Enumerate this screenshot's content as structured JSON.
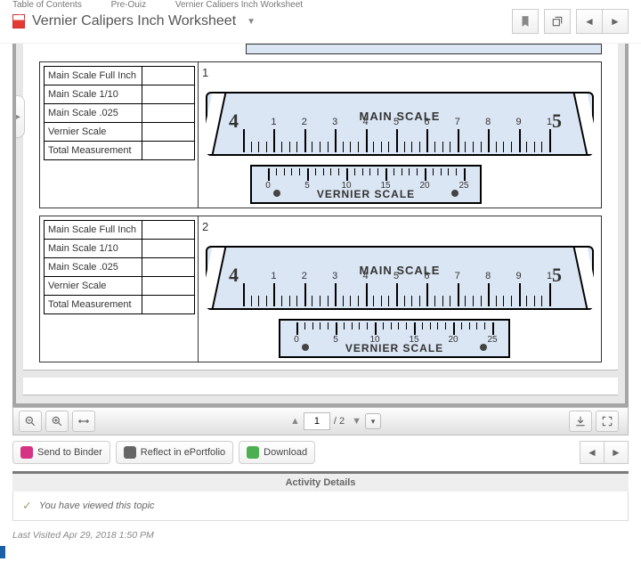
{
  "breadcrumb": {
    "toc": "Table of Contents",
    "unit": "Pre-Quiz",
    "doc": "Vernier Calipers Inch Worksheet"
  },
  "title": "Vernier Calipers Inch Worksheet",
  "rows": {
    "r0": "Main Scale Full Inch",
    "r1": "Main Scale 1/10",
    "r2": "Main Scale .025",
    "r3": "Vernier Scale",
    "r4": "Total Measurement"
  },
  "scale": {
    "main_label": "MAIN SCALE",
    "vern_label": "VERNIER SCALE",
    "big_left": "4",
    "big_right": "5",
    "main_ticks": [
      "1",
      "2",
      "3",
      "4",
      "5",
      "6",
      "7",
      "8",
      "9",
      "1"
    ],
    "vern_ticks": [
      "0",
      "5",
      "10",
      "15",
      "20",
      "25"
    ]
  },
  "ex": {
    "n1": "1",
    "n2": "2"
  },
  "paging": {
    "current": "1",
    "sep": "/",
    "total": "2"
  },
  "actions": {
    "binder": "Send to Binder",
    "reflect": "Reflect in ePortfolio",
    "download": "Download"
  },
  "activity": {
    "header": "Activity Details",
    "viewed": "You have viewed this topic"
  },
  "last_visited": {
    "label": "Last Visited ",
    "stamp": "Apr 29, 2018 1:50 PM"
  }
}
